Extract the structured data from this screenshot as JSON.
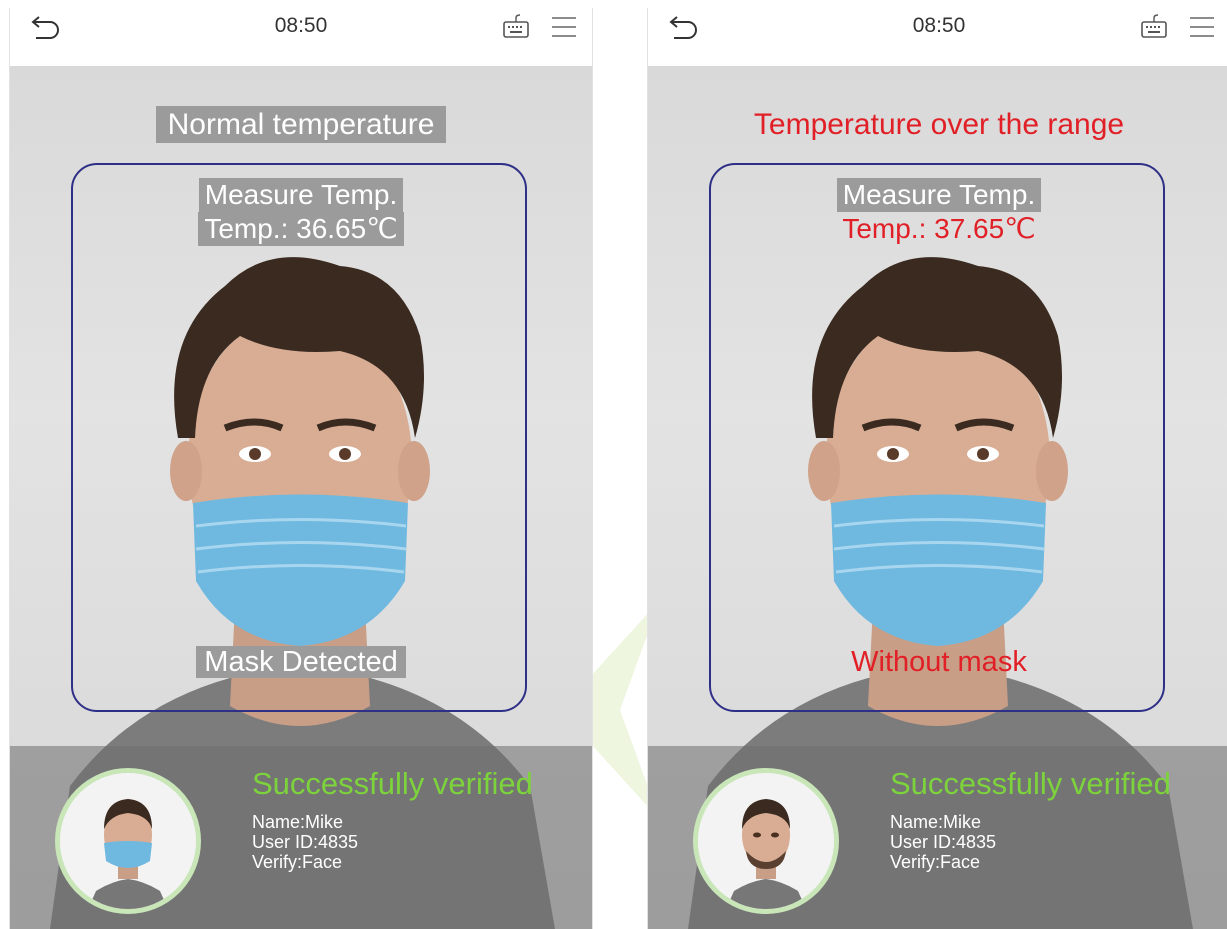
{
  "screens": [
    {
      "clock": "08:50",
      "status": "Normal temperature",
      "status_color": "#ffffff",
      "measure_label": "Measure Temp.",
      "temp_label": "Temp.: 36.65℃",
      "mask_status": "Mask Detected",
      "avatar_masked": true,
      "result": {
        "title": "Successfully verified",
        "name": "Name:Mike",
        "user_id": "User ID:4835",
        "verify": "Verify:Face"
      }
    },
    {
      "clock": "08:50",
      "status": "Temperature over the range",
      "status_color": "#e11f26",
      "measure_label": "Measure Temp.",
      "temp_label": "Temp.: 37.65℃",
      "mask_status": "Without mask",
      "avatar_masked": false,
      "result": {
        "title": "Successfully verified",
        "name": "Name:Mike",
        "user_id": "User ID:4835",
        "verify": "Verify:Face"
      }
    }
  ],
  "icons": {
    "back": "back-arrow-icon",
    "keyboard": "keyboard-icon",
    "menu": "menu-icon"
  },
  "colors": {
    "frame": "#2e2f86",
    "alert_red": "#e11f26",
    "success_green": "#7cd33b",
    "avatar_ring": "#c8e6b7"
  }
}
